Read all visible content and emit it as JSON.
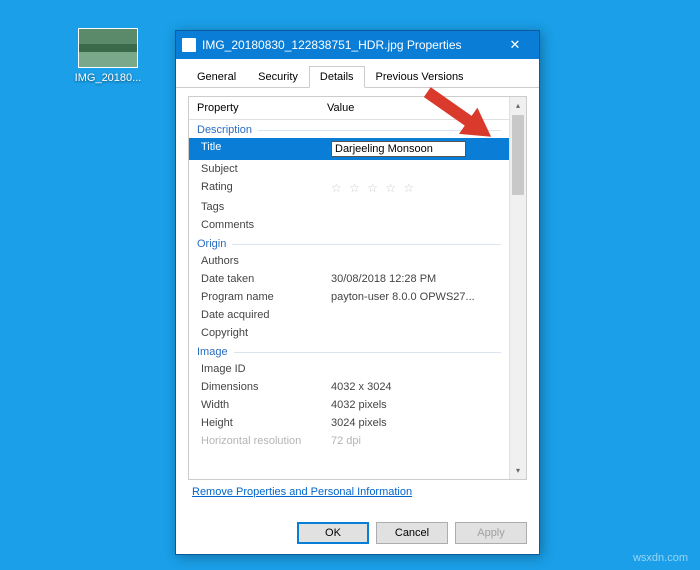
{
  "desktop": {
    "icon_label": "IMG_20180..."
  },
  "window": {
    "title": "IMG_20180830_122838751_HDR.jpg Properties"
  },
  "tabs": {
    "general": "General",
    "security": "Security",
    "details": "Details",
    "previous": "Previous Versions"
  },
  "headers": {
    "property": "Property",
    "value": "Value"
  },
  "sections": {
    "description": "Description",
    "origin": "Origin",
    "image": "Image"
  },
  "description": {
    "title_label": "Title",
    "title_value": "Darjeeling Monsoon",
    "subject_label": "Subject",
    "rating_label": "Rating",
    "rating_value": "☆ ☆ ☆ ☆ ☆",
    "tags_label": "Tags",
    "comments_label": "Comments"
  },
  "origin": {
    "authors_label": "Authors",
    "date_taken_label": "Date taken",
    "date_taken_value": "30/08/2018 12:28 PM",
    "program_name_label": "Program name",
    "program_name_value": "payton-user 8.0.0 OPWS27...",
    "date_acquired_label": "Date acquired",
    "copyright_label": "Copyright"
  },
  "image": {
    "image_id_label": "Image ID",
    "dimensions_label": "Dimensions",
    "dimensions_value": "4032 x 3024",
    "width_label": "Width",
    "width_value": "4032 pixels",
    "height_label": "Height",
    "height_value": "3024 pixels",
    "hres_label": "Horizontal resolution",
    "hres_value": "72 dpi"
  },
  "links": {
    "remove": "Remove Properties and Personal Information"
  },
  "buttons": {
    "ok": "OK",
    "cancel": "Cancel",
    "apply": "Apply"
  },
  "watermark": "wsxdn.com"
}
